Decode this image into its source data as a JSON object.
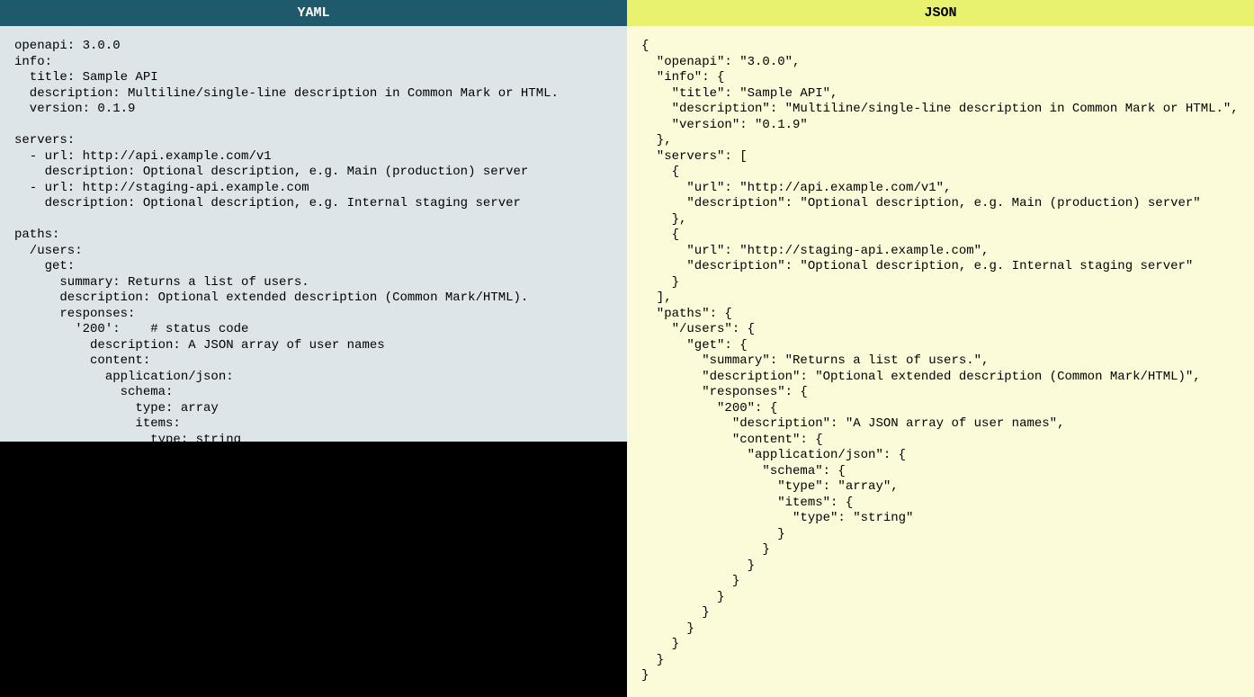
{
  "left": {
    "header": "YAML",
    "code": "openapi: 3.0.0\ninfo:\n  title: Sample API\n  description: Multiline/single-line description in Common Mark or HTML.\n  version: 0.1.9\n\nservers:\n  - url: http://api.example.com/v1\n    description: Optional description, e.g. Main (production) server\n  - url: http://staging-api.example.com\n    description: Optional description, e.g. Internal staging server\n\npaths:\n  /users:\n    get:\n      summary: Returns a list of users.\n      description: Optional extended description (Common Mark/HTML).\n      responses:\n        '200':    # status code\n          description: A JSON array of user names\n          content:\n            application/json:\n              schema:\n                type: array\n                items:\n                  type: string"
  },
  "right": {
    "header": "JSON",
    "code": "{\n  \"openapi\": \"3.0.0\",\n  \"info\": {\n    \"title\": \"Sample API\",\n    \"description\": \"Multiline/single-line description in Common Mark or HTML.\",\n    \"version\": \"0.1.9\"\n  },\n  \"servers\": [\n    {\n      \"url\": \"http://api.example.com/v1\",\n      \"description\": \"Optional description, e.g. Main (production) server\"\n    },\n    {\n      \"url\": \"http://staging-api.example.com\",\n      \"description\": \"Optional description, e.g. Internal staging server\"\n    }\n  ],\n  \"paths\": {\n    \"/users\": {\n      \"get\": {\n        \"summary\": \"Returns a list of users.\",\n        \"description\": \"Optional extended description (Common Mark/HTML)\",\n        \"responses\": {\n          \"200\": {\n            \"description\": \"A JSON array of user names\",\n            \"content\": {\n              \"application/json\": {\n                \"schema\": {\n                  \"type\": \"array\",\n                  \"items\": {\n                    \"type\": \"string\"\n                  }\n                }\n              }\n            }\n          }\n        }\n      }\n    }\n  }\n}"
  }
}
